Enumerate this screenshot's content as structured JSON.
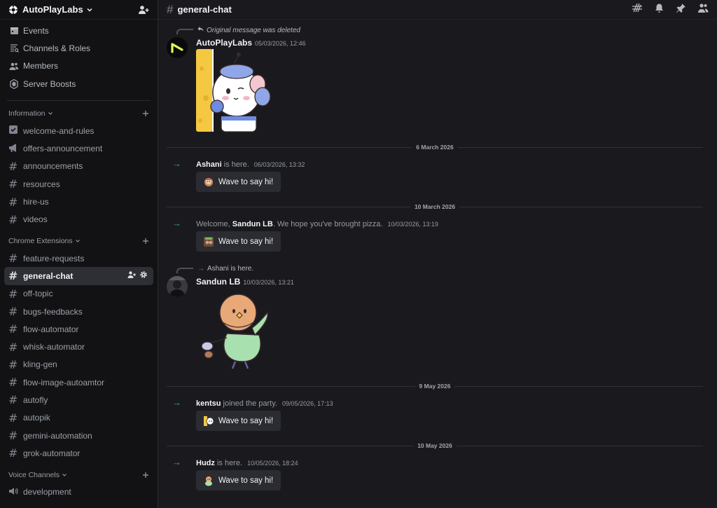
{
  "server": {
    "name": "AutoPlayLabs"
  },
  "top_nav": [
    {
      "label": "Events",
      "icon": "calendar-icon"
    },
    {
      "label": "Channels & Roles",
      "icon": "channels-roles-icon"
    },
    {
      "label": "Members",
      "icon": "members-icon"
    },
    {
      "label": "Server Boosts",
      "icon": "boost-icon"
    }
  ],
  "categories": {
    "information": {
      "label": "Information",
      "channels": [
        "welcome-and-rules",
        "offers-announcement",
        "announcements",
        "resources",
        "hire-us",
        "videos"
      ]
    },
    "chrome": {
      "label": "Chrome Extensions",
      "channels": [
        "feature-requests",
        "general-chat",
        "off-topic",
        "bugs-feedbacks",
        "flow-automator",
        "whisk-automator",
        "kling-gen",
        "flow-image-autoamtor",
        "autofly",
        "autopik",
        "gemini-automation",
        "grok-automator"
      ]
    },
    "voice": {
      "label": "Voice Channels",
      "channels": [
        "development"
      ]
    }
  },
  "active_channel": "general-chat",
  "messages": {
    "m1": {
      "reply": "Original message was deleted",
      "author": "AutoPlayLabs",
      "timestamp": "05/03/2026, 12:46"
    },
    "d1": "6 March 2026",
    "j1": {
      "name": "Ashani",
      "text": " is here. ",
      "timestamp": "06/03/2026, 13:32",
      "button": "Wave to say hi!"
    },
    "d2": "10 March 2026",
    "j2": {
      "pre": "Welcome, ",
      "name": "Sandun LB",
      "text": ". We hope you've brought pizza. ",
      "timestamp": "10/03/2026, 13:19",
      "button": "Wave to say hi!"
    },
    "m2": {
      "reply_arrow": "→",
      "reply": "Ashani is here.",
      "author": "Sandun LB",
      "timestamp": "10/03/2026, 13:21"
    },
    "d3": "9 May 2026",
    "j3": {
      "name": "kentsu",
      "text": " joined the party. ",
      "timestamp": "09/05/2026, 17:13",
      "button": "Wave to say hi!"
    },
    "d4": "10 May 2026",
    "j4": {
      "name": "Hudz",
      "text": " is here. ",
      "timestamp": "10/05/2026, 18:24",
      "button": "Wave to say hi!"
    }
  },
  "colors": {
    "join_arrow": "#3ba55c",
    "background": "#1a1a1e",
    "sidebar": "#121214"
  }
}
